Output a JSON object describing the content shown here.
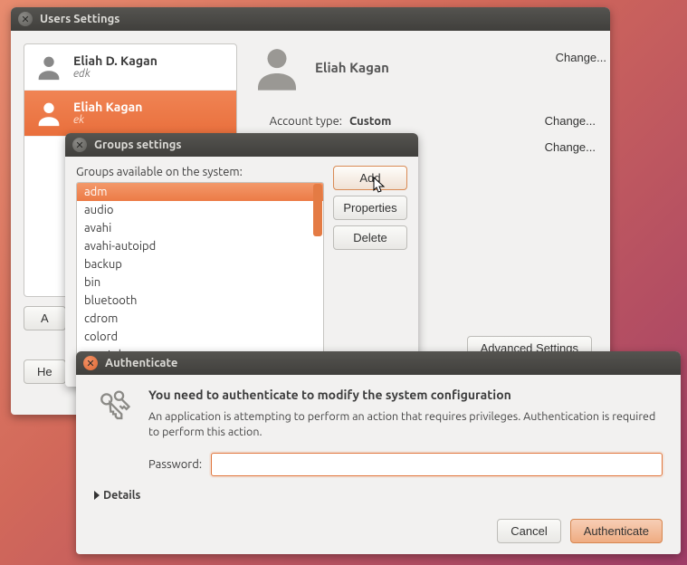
{
  "users_window": {
    "title": "Users Settings",
    "list": [
      {
        "name": "Eliah D. Kagan",
        "sub": "edk"
      },
      {
        "name": "Eliah Kagan",
        "sub": "ek"
      }
    ],
    "profile_name": "Eliah Kagan",
    "account_type_label": "Account type:",
    "account_type_value": "Custom",
    "change_label": "Change...",
    "left_buttons": {
      "add": "A",
      "help": "He"
    },
    "advanced_button": "Advanced Settings"
  },
  "groups_window": {
    "title": "Groups settings",
    "caption": "Groups available on the system:",
    "items": [
      "adm",
      "audio",
      "avahi",
      "avahi-autoipd",
      "backup",
      "bin",
      "bluetooth",
      "cdrom",
      "colord",
      "crontab"
    ],
    "buttons": {
      "add": "Add",
      "properties": "Properties",
      "delete": "Delete"
    }
  },
  "auth_window": {
    "title": "Authenticate",
    "heading": "You need to authenticate to modify the system configuration",
    "desc": "An application is attempting to perform an action that requires privileges. Authentication is required to perform this action.",
    "password_label": "Password:",
    "details_label": "Details",
    "buttons": {
      "cancel": "Cancel",
      "authenticate": "Authenticate"
    }
  }
}
